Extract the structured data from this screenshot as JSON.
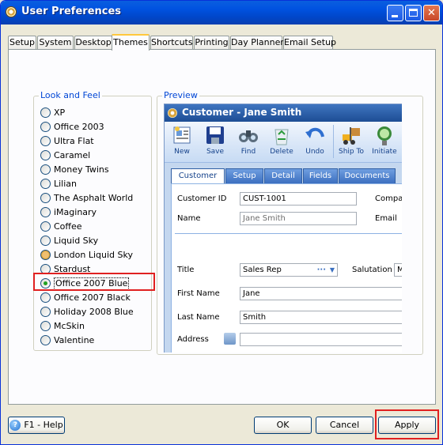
{
  "window": {
    "title": "User Preferences",
    "minimize_label": "_",
    "close_glyph": "✕"
  },
  "tabs": [
    "Setup",
    "System",
    "Desktop",
    "Themes",
    "Shortcuts",
    "Printing",
    "Day Planner",
    "Email Setup"
  ],
  "active_tab": "Themes",
  "look_and_feel": {
    "title": "Look and Feel",
    "selected": "Office 2007 Blue",
    "options": [
      "XP",
      "Office 2003",
      "Ultra Flat",
      "Caramel",
      "Money Twins",
      "Lilian",
      "The Asphalt World",
      "iMaginary",
      "Coffee",
      "Liquid Sky",
      "London Liquid Sky",
      "Stardust",
      "Office 2007 Blue",
      "Office 2007 Black",
      "Holiday 2008 Blue",
      "McSkin",
      "Valentine"
    ]
  },
  "preview": {
    "title": "Preview",
    "window_title": "Customer - Jane Smith",
    "toolbar": [
      "New",
      "Save",
      "Find",
      "Delete",
      "Undo",
      "Ship To",
      "Initiate"
    ],
    "tabs": [
      "Customer",
      "Setup",
      "Detail",
      "Fields",
      "Documents"
    ],
    "fields": {
      "customer_id_label": "Customer ID",
      "customer_id": "CUST-1001",
      "company_label": "Compa",
      "name_label": "Name",
      "name": "Jane Smith",
      "email_label": "Email",
      "title_label": "Title",
      "title": "Sales Rep",
      "dropdown_dots": "···",
      "salutation_label": "Salutation",
      "salutation_value": "M",
      "first_name_label": "First Name",
      "first_name": "Jane",
      "last_name_label": "Last Name",
      "last_name": "Smith",
      "address_label": "Address"
    }
  },
  "buttons": {
    "help": "F1 - Help",
    "ok": "OK",
    "cancel": "Cancel",
    "apply": "Apply"
  },
  "colors": {
    "titlebar": "#0052e0",
    "group_title": "#0046d5",
    "highlight": "#e02020"
  }
}
